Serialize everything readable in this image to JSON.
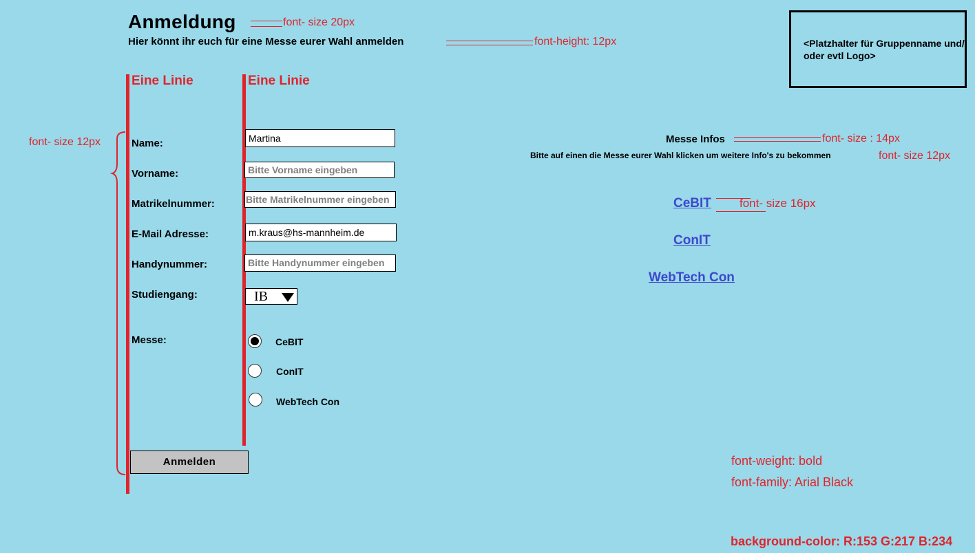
{
  "header": {
    "title": "Anmeldung",
    "subtitle": "Hier könnt ihr euch für eine Messe eurer Wahl anmelden"
  },
  "annotations": {
    "title_size": "font- size   20px",
    "subtitle_size": "font-height: 12px",
    "form_size": "font- size   12px",
    "info_title_size": "font- size  : 14px",
    "info_hint_size": "font- size   12px",
    "link_size": "font-   size    16px",
    "weight": "font-weight: bold",
    "family": "font-family: Arial Black",
    "background": "background-color: R:153 G:217 B:234",
    "line_left": "Eine Linie",
    "line_right": "Eine Linie"
  },
  "form": {
    "name_label": "Name:",
    "name_value": "Martina",
    "vorname_label": "Vorname:",
    "vorname_placeholder": "Bitte Vorname eingeben",
    "matrikel_label": "Matrikelnummer:",
    "matrikel_placeholder": "Bitte Matrikelnummer eingeben",
    "email_label": "E-Mail Adresse:",
    "email_value": "m.kraus@hs-mannheim.de",
    "handy_label": "Handynummer:",
    "handy_placeholder": "Bitte Handynummer eingeben",
    "studiengang_label": "Studiengang:",
    "studiengang_value": "IB",
    "messe_label": "Messe:",
    "messe_options": [
      "CeBIT",
      "ConIT",
      "WebTech Con"
    ],
    "messe_selected": "CeBIT",
    "submit_label": "Anmelden"
  },
  "logo": {
    "placeholder": "<Platzhalter für Gruppenname und/ oder evtl Logo>"
  },
  "info": {
    "title": "Messe Infos",
    "hint": "Bitte auf einen die Messe eurer Wahl klicken um weitere Info's zu bekommen",
    "links": [
      "CeBIT",
      "ConIT",
      "WebTech Con"
    ]
  },
  "colors": {
    "background": "#99d9ea",
    "annotation": "#e0242b",
    "link": "#3f48cc",
    "button": "#c3c3c3"
  }
}
